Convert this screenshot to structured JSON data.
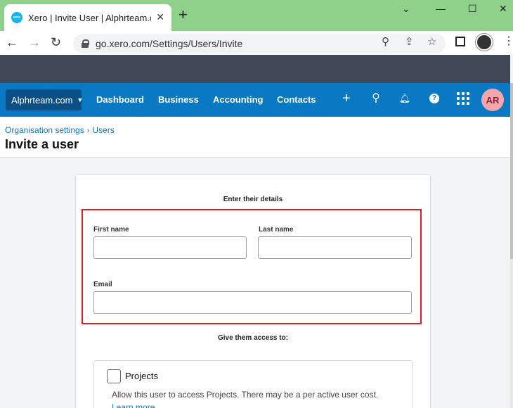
{
  "browser": {
    "tab_title": "Xero | Invite User | Alphrteam.com",
    "favicon_text": "xero",
    "url": "go.xero.com/Settings/Users/Invite"
  },
  "nav": {
    "org_name": "Alphrteam.com",
    "links": [
      "Dashboard",
      "Business",
      "Accounting",
      "Contacts"
    ],
    "avatar_initials": "AR",
    "accent_color": "#0b78c3"
  },
  "breadcrumb": {
    "items": [
      "Organisation settings",
      "Users"
    ]
  },
  "page": {
    "title": "Invite a user"
  },
  "form": {
    "details_heading": "Enter their details",
    "first_name_label": "First name",
    "last_name_label": "Last name",
    "email_label": "Email",
    "first_name_value": "",
    "last_name_value": "",
    "email_value": "",
    "access_heading": "Give them access to:",
    "projects_label": "Projects",
    "projects_desc": "Allow this user to access Projects. There may be a per active user cost.",
    "learn_more": "Learn more"
  }
}
